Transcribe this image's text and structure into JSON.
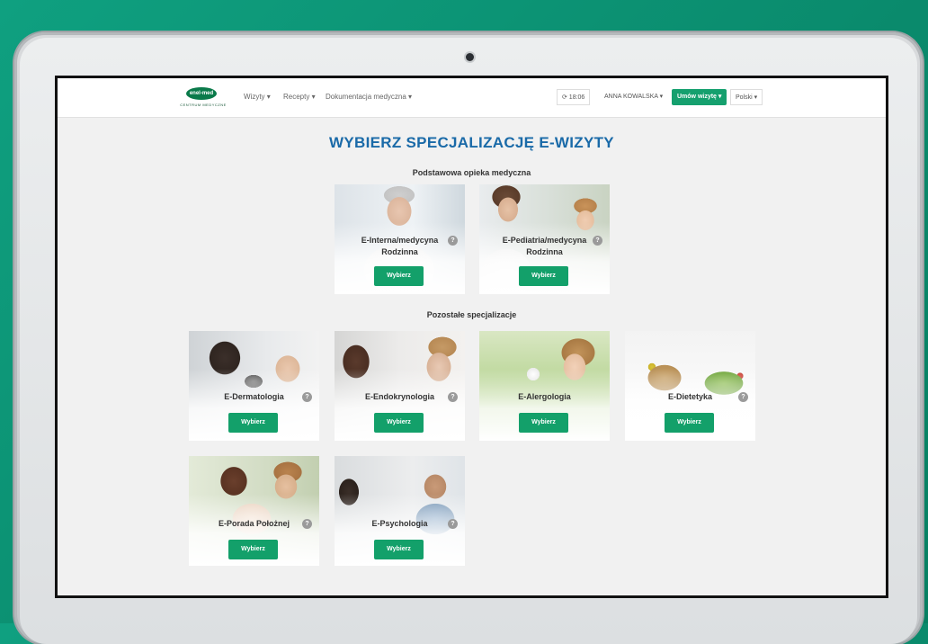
{
  "nav": {
    "logo_text": "enel-med",
    "logo_sub": "CENTRUM MEDYCZNE",
    "links": [
      "Wizyty ▾",
      "Recepty ▾",
      "Dokumentacja medyczna ▾"
    ],
    "clock": "⟳ 18:06",
    "user": "ANNA KOWALSKA ▾",
    "cta": "Umów wizytę ▾",
    "lang": "Polski ▾"
  },
  "page": {
    "title": "WYBIERZ SPECJALIZACJĘ E-WIZYTY",
    "section1": "Podstawowa opieka medyczna",
    "section2": "Pozostałe specjalizacje"
  },
  "cards": [
    {
      "line1": "E-Interna/medycyna",
      "line2": "Rodzinna",
      "button": "Wybierz"
    },
    {
      "line1": "E-Pediatria/medycyna",
      "line2": "Rodzinna",
      "button": "Wybierz"
    },
    {
      "line1": "E-Dermatologia",
      "button": "Wybierz"
    },
    {
      "line1": "E-Endokrynologia",
      "button": "Wybierz"
    },
    {
      "line1": "E-Alergologia",
      "button": "Wybierz"
    },
    {
      "line1": "E-Dietetyka",
      "button": "Wybierz"
    },
    {
      "line1": "E-Porada Położnej",
      "button": "Wybierz"
    },
    {
      "line1": "E-Psychologia",
      "button": "Wybierz"
    }
  ],
  "info_glyph": "?",
  "colors": {
    "accent": "#13a06a",
    "title": "#1a6aa8",
    "background": "#0a8a6c"
  }
}
